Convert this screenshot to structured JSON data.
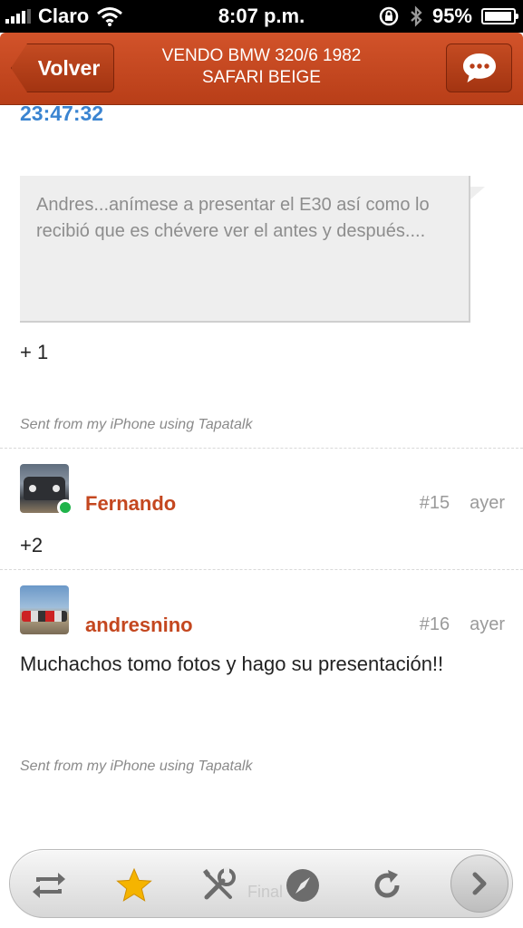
{
  "status_bar": {
    "carrier": "Claro",
    "time": "8:07 p.m.",
    "battery": "95%",
    "battery_level": 0.95
  },
  "nav": {
    "back_label": "Volver",
    "title_line1": "VENDO BMW 320/6 1982",
    "title_line2": "SAFARI BEIGE",
    "reply_icon": "chat-bubble-icon"
  },
  "thread": {
    "top_timestamp": "23:47:32",
    "quote_text": "Andres...anímese a presentar el E30 así como lo recibió que es chévere ver el antes y después....",
    "reply_text": "+ 1",
    "signature": "Sent from my iPhone using Tapatalk"
  },
  "posts": [
    {
      "username": "Fernando",
      "number": "#15",
      "date": "ayer",
      "body": "+2",
      "online": true
    },
    {
      "username": "andresnino",
      "number": "#16",
      "date": "ayer",
      "body": "Muchachos tomo fotos y hago su presentación!!",
      "signature": "Sent from my iPhone using Tapatalk"
    }
  ],
  "toolbar": {
    "ghost_label": "Final",
    "icons": [
      "repost-icon",
      "star-icon",
      "tools-icon",
      "compass-icon",
      "refresh-icon",
      "chevron-right-icon"
    ]
  },
  "colors": {
    "accent": "#c4471f",
    "link_blue": "#3a84d1",
    "star": "#f5b400",
    "online": "#1fb34a"
  }
}
